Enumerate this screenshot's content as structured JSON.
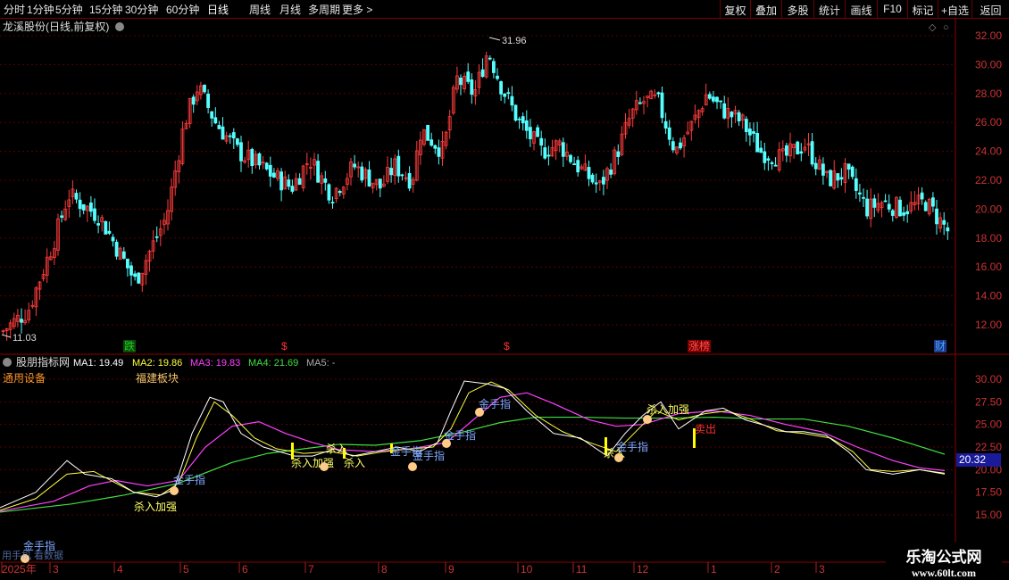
{
  "toolbar": {
    "periods": [
      "分时",
      "1分钟",
      "5分钟",
      "15分钟",
      "30分钟",
      "60分钟",
      "日线",
      "周线",
      "月线",
      "多周期",
      "更多 >"
    ],
    "active_period": "日线",
    "tools": [
      "复权",
      "叠加",
      "多股",
      "统计",
      "画线",
      "F10",
      "标记",
      "+自选",
      "返回"
    ]
  },
  "main_panel": {
    "title": "龙溪股份(日线,前复权)",
    "price_axis": [
      "32.00",
      "30.00",
      "28.00",
      "26.00",
      "24.00",
      "22.00",
      "20.00",
      "18.00",
      "16.00",
      "14.00",
      "12.00"
    ],
    "high_label": "31.96",
    "low_label": "11.03",
    "markers": [
      {
        "text": "跌",
        "color": "#22cc22"
      },
      {
        "text": "$",
        "color": "#ff3030"
      },
      {
        "text": "$",
        "color": "#ff3030"
      },
      {
        "text": "涨榜",
        "color": "#ff5050"
      },
      {
        "text": "财",
        "color": "#4aa0ff"
      }
    ]
  },
  "indicator_panel": {
    "title": "股朋指标网",
    "ma": [
      {
        "label": "MA1: 19.49",
        "color": "#ffffff"
      },
      {
        "label": "MA2: 19.86",
        "color": "#ffff40"
      },
      {
        "label": "MA3: 19.83",
        "color": "#ff40ff"
      },
      {
        "label": "MA4: 21.69",
        "color": "#40e040"
      },
      {
        "label": "MA5: -",
        "color": "#aaaaaa"
      }
    ],
    "industry": "通用设备",
    "sector": "福建板块",
    "axis": [
      "30.00",
      "27.50",
      "25.00",
      "22.50",
      "20.00",
      "17.50",
      "15.00"
    ],
    "current_value": "20.32",
    "signals": [
      {
        "text": "金手指",
        "color": "#7fa8ff"
      },
      {
        "text": "杀入加强",
        "color": "#ffff66"
      },
      {
        "text": "金手指",
        "color": "#7fa8ff"
      },
      {
        "text": "杀入加强",
        "color": "#ffff66"
      },
      {
        "text": "杀入",
        "color": "#ffff66"
      },
      {
        "text": "杀入",
        "color": "#ffff66"
      },
      {
        "text": "金手指",
        "color": "#7fa8ff"
      },
      {
        "text": "金手指",
        "color": "#7fa8ff"
      },
      {
        "text": "金手指",
        "color": "#7fa8ff"
      },
      {
        "text": "杀入",
        "color": "#ffff66"
      },
      {
        "text": "金手指",
        "color": "#7fa8ff"
      },
      {
        "text": "金手指",
        "color": "#7fa8ff"
      },
      {
        "text": "杀入加强",
        "color": "#ffff66"
      },
      {
        "text": "卖出",
        "color": "#ff3030"
      }
    ],
    "ticker_text": "用手机 看数据"
  },
  "time_axis": [
    "2025年",
    "3",
    "4",
    "5",
    "6",
    "7",
    "8",
    "9",
    "10",
    "11",
    "12",
    "1",
    "2",
    "3"
  ],
  "watermark": {
    "title": "乐淘公式网",
    "url": "www.60lt.com"
  },
  "colors": {
    "up": "#ff3c3c",
    "down": "#55ffff",
    "grid": "#5a0000",
    "axis": "#8a0000",
    "text": "#cccccc"
  }
}
